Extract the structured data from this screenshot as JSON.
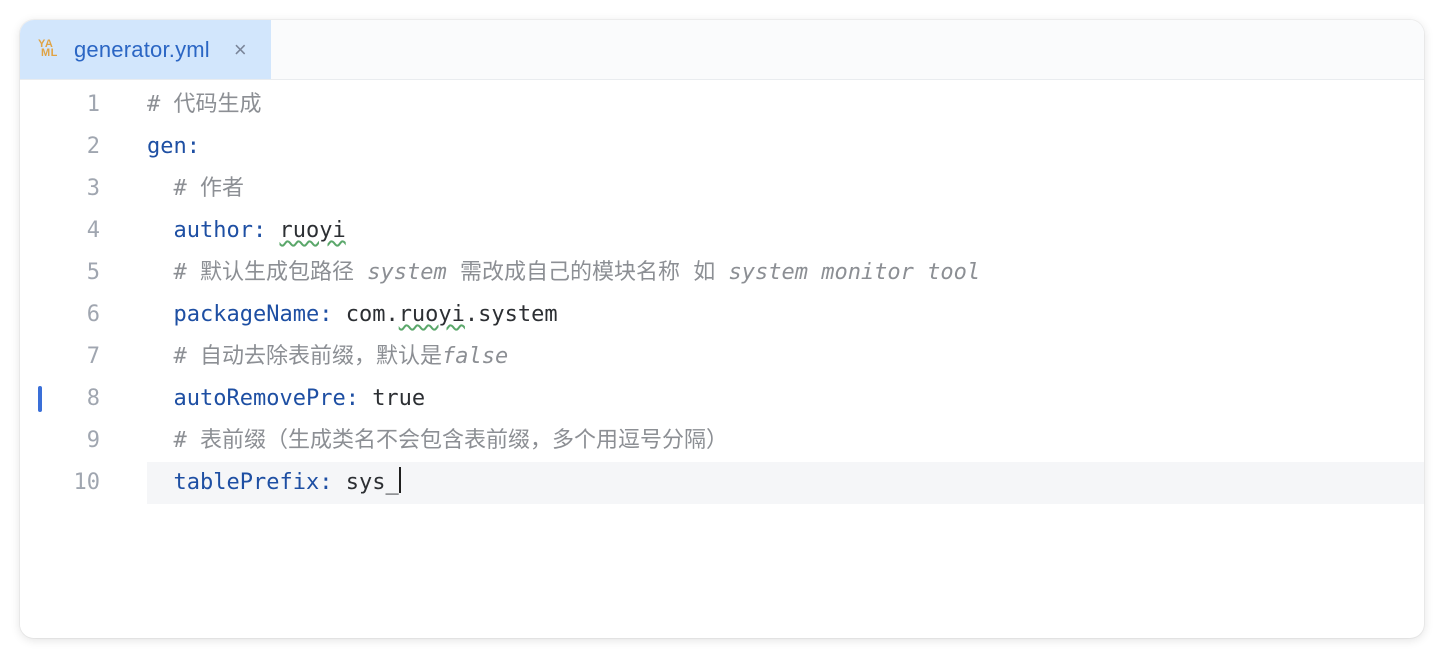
{
  "tab": {
    "file_name": "generator.yml",
    "icon_name": "yaml-icon",
    "close_label": "×"
  },
  "editor": {
    "cursor_line": 10,
    "changed_line": 8,
    "line_numbers": [
      "1",
      "2",
      "3",
      "4",
      "5",
      "6",
      "7",
      "8",
      "9",
      "10"
    ],
    "lines": [
      {
        "indent": "",
        "parts": [
          {
            "cls": "tok-comment",
            "text": "# 代码生成"
          }
        ]
      },
      {
        "indent": "",
        "parts": [
          {
            "cls": "tok-key",
            "text": "gen"
          },
          {
            "cls": "tok-colon",
            "text": ":"
          }
        ]
      },
      {
        "indent": "  ",
        "parts": [
          {
            "cls": "tok-comment",
            "text": "# 作者"
          }
        ]
      },
      {
        "indent": "  ",
        "parts": [
          {
            "cls": "tok-key",
            "text": "author"
          },
          {
            "cls": "tok-colon",
            "text": ": "
          },
          {
            "cls": "tok-value warn-underline",
            "text": "ruoyi"
          }
        ]
      },
      {
        "indent": "  ",
        "parts": [
          {
            "cls": "tok-comment",
            "text": "# 默认生成包路径 "
          },
          {
            "cls": "tok-comment-italic",
            "text": "system"
          },
          {
            "cls": "tok-comment",
            "text": " 需改成自己的模块名称 如 "
          },
          {
            "cls": "tok-comment-italic",
            "text": "system monitor tool"
          }
        ]
      },
      {
        "indent": "  ",
        "parts": [
          {
            "cls": "tok-key",
            "text": "packageName"
          },
          {
            "cls": "tok-colon",
            "text": ": "
          },
          {
            "cls": "tok-value",
            "text": "com."
          },
          {
            "cls": "tok-value warn-underline",
            "text": "ruoyi"
          },
          {
            "cls": "tok-value",
            "text": ".system"
          }
        ]
      },
      {
        "indent": "  ",
        "parts": [
          {
            "cls": "tok-comment",
            "text": "# 自动去除表前缀，默认是"
          },
          {
            "cls": "tok-comment-italic",
            "text": "false"
          }
        ]
      },
      {
        "indent": "  ",
        "parts": [
          {
            "cls": "tok-key",
            "text": "autoRemovePre"
          },
          {
            "cls": "tok-colon",
            "text": ": "
          },
          {
            "cls": "tok-value",
            "text": "true"
          }
        ]
      },
      {
        "indent": "  ",
        "parts": [
          {
            "cls": "tok-comment",
            "text": "# 表前缀（生成类名不会包含表前缀，多个用逗号分隔）"
          }
        ]
      },
      {
        "indent": "  ",
        "parts": [
          {
            "cls": "tok-key",
            "text": "tablePrefix"
          },
          {
            "cls": "tok-colon",
            "text": ": "
          },
          {
            "cls": "tok-value",
            "text": "sys_"
          }
        ]
      }
    ]
  }
}
